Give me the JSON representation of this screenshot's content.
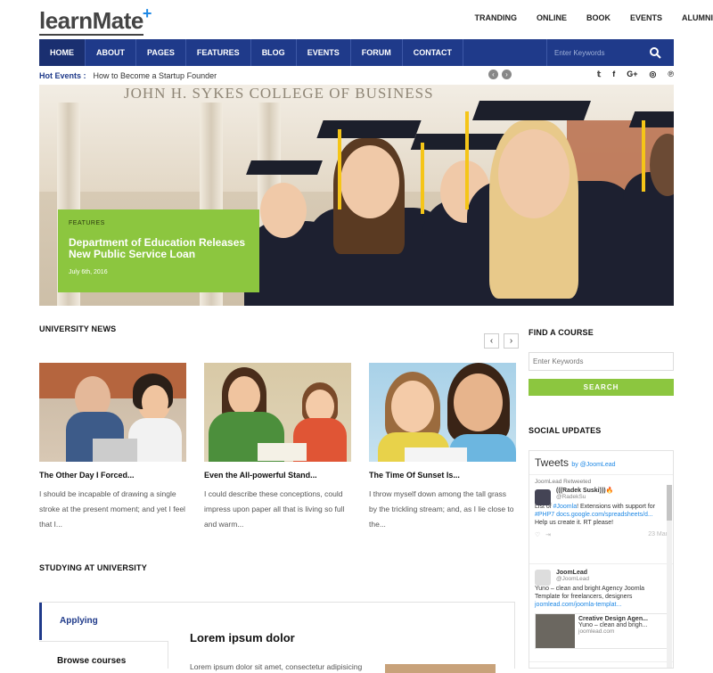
{
  "brand": {
    "logo_text": "learnMate",
    "accent": "#1e88e5",
    "nav_color": "#1f3a8a",
    "green": "#8cc63f"
  },
  "topnav": [
    "TRANDING",
    "ONLINE",
    "BOOK",
    "EVENTS",
    "ALUMNI"
  ],
  "mainnav": {
    "items": [
      "HOME",
      "ABOUT",
      "PAGES",
      "FEATURES",
      "BLOG",
      "EVENTS",
      "FORUM",
      "CONTACT"
    ],
    "search_placeholder": "Enter Keywords"
  },
  "hotbar": {
    "label": "Hot Events :",
    "text": "How to Become a Startup Founder"
  },
  "hero": {
    "sign": "JOHN H. SYKES COLLEGE OF BUSINESS",
    "category": "FEATURES",
    "title": "Department of Education Releases New Public Service Loan",
    "date": "July 6th, 2016"
  },
  "news": {
    "heading": "UNIVERSITY NEWS",
    "cards": [
      {
        "title": "The Other Day I Forced...",
        "desc": "I should be incapable of drawing a single stroke at the present moment; and yet I feel that I..."
      },
      {
        "title": "Even the All-powerful Stand...",
        "desc": "I could describe these conceptions, could impress upon paper all that is living so full and warm..."
      },
      {
        "title": "The Time Of Sunset Is...",
        "desc": "I throw myself down among the tall grass by the trickling stream; and, as I lie close to the..."
      }
    ]
  },
  "sidebar": {
    "find_heading": "FIND A COURSE",
    "find_placeholder": "Enter Keywords",
    "find_button": "SEARCH",
    "social_heading": "SOCIAL UPDATES",
    "tweets_title": "Tweets",
    "tweets_by": "by @JoomLead",
    "tweets": [
      {
        "retweet": "JoomLead Retweeted",
        "name": "(((Radek Suski)))🔥",
        "handle": "@RadekSu",
        "text_a": "List of ",
        "tag1": "#Joomla",
        "text_b": "! Extensions with support for ",
        "tag2": "#PHP7",
        "link": " docs.google.com/spreadsheets/d...",
        "text_c": "Help us create it. RT please!",
        "date": "23 Mar"
      },
      {
        "name": "JoomLead",
        "handle": "@JoomLead",
        "text": "Yuno – clean and bright Agency Joomla Template for freelancers, designers",
        "link": "joomlead.com/joomla-templat...",
        "preview_title": "Creative Design Agen...",
        "preview_text": "Yuno – clean and brigh...",
        "preview_link": "joomlead.com"
      }
    ]
  },
  "studying": {
    "heading": "STUDYING AT UNIVERSITY",
    "tabs": [
      "Applying",
      "Browse courses"
    ],
    "content_title": "Lorem ipsum dolor",
    "content_text": "Lorem ipsum dolor sit amet, consectetur adipisicing"
  }
}
